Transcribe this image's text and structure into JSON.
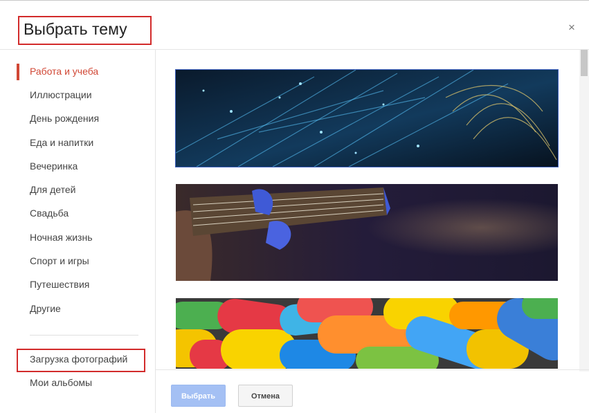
{
  "dialog": {
    "title": "Выбрать тему",
    "close_glyph": "×"
  },
  "sidebar": {
    "categories": [
      {
        "label": "Работа и учеба",
        "active": true
      },
      {
        "label": "Иллюстрации"
      },
      {
        "label": "День рождения"
      },
      {
        "label": "Еда и напитки"
      },
      {
        "label": "Вечеринка"
      },
      {
        "label": "Для детей"
      },
      {
        "label": "Свадьба"
      },
      {
        "label": "Ночная жизнь"
      },
      {
        "label": "Спорт и игры"
      },
      {
        "label": "Путешествия"
      },
      {
        "label": "Другие"
      }
    ],
    "photo_items": [
      {
        "label": "Загрузка фотографий"
      },
      {
        "label": "Мои альбомы"
      }
    ]
  },
  "themes": [
    {
      "name": "fiber-optics-theme"
    },
    {
      "name": "guitar-theme"
    },
    {
      "name": "candy-theme"
    }
  ],
  "footer": {
    "select_label": "Выбрать",
    "cancel_label": "Отмена"
  },
  "colors": {
    "accent_active": "#d14836",
    "highlight_box": "#d22b2b",
    "select_button": "#a4c0f4"
  }
}
